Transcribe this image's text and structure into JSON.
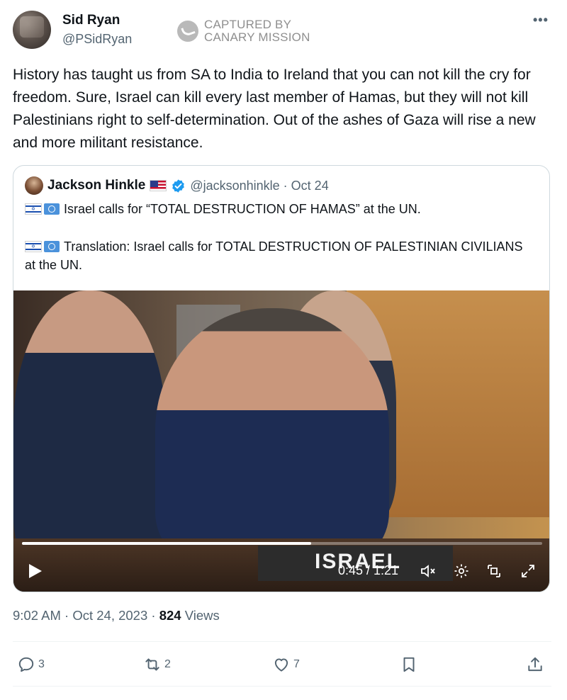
{
  "author": {
    "name": "Sid Ryan",
    "handle": "@PSidRyan"
  },
  "stamp": {
    "line1": "CAPTURED BY",
    "line2": "CANARY MISSION"
  },
  "more_menu": "•••",
  "tweet_text": "History has taught us from SA to India to Ireland that you can not kill the cry for freedom. Sure, Israel can kill every last member of Hamas, but they will not kill Palestinians right to self-determination. Out of the ashes of Gaza will rise a new and more militant resistance.",
  "quoted": {
    "name": "Jackson Hinkle",
    "handle_date": "@jacksonhinkle · Oct 24",
    "line1": "Israel calls for “TOTAL DESTRUCTION OF HAMAS” at the UN.",
    "line2": "Translation: Israel calls for TOTAL DESTRUCTION OF PALESTINIAN CIVILIANS at the UN.",
    "video": {
      "time": "0:45 / 1:21",
      "progress_fraction": 0.556,
      "sign_text": "ISRAEL"
    }
  },
  "meta": {
    "time_date": "9:02 AM · Oct 24, 2023 · ",
    "views_count": "824",
    "views_label": " Views"
  },
  "actions": {
    "replies": "3",
    "retweets": "2",
    "likes": "7"
  },
  "colors": {
    "text_primary": "#0f1419",
    "text_secondary": "#536471",
    "verified": "#1d9bf0",
    "border": "#cfd9de"
  }
}
